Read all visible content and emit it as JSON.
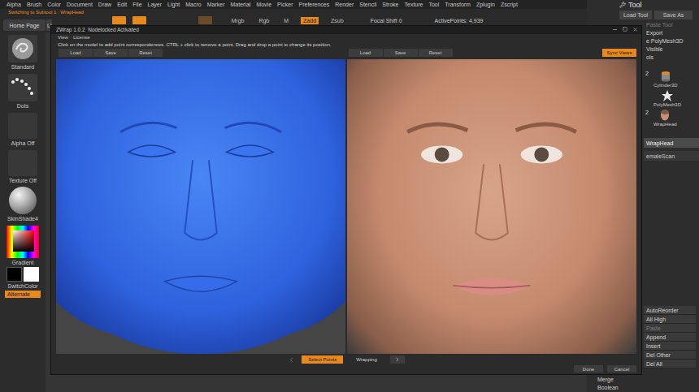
{
  "menu_bar": [
    "Alpha",
    "Brush",
    "Color",
    "Document",
    "Draw",
    "Edit",
    "File",
    "Layer",
    "Light",
    "Macro",
    "Marker",
    "Material",
    "Movie",
    "Picker",
    "Preferences",
    "Render",
    "Stencil",
    "Stroke",
    "Texture",
    "Tool",
    "Transform",
    "Zplugin",
    "Zscript"
  ],
  "status_message": "Switching to Subtool 1 : WrapHead",
  "toolbar": {
    "home_button": "Home Page",
    "partial_button": "Li",
    "tool_buttons": [
      {
        "selected": true
      },
      {
        "selected": true
      },
      {
        "selected": false
      }
    ],
    "modes": [
      {
        "label": "Mrgb",
        "selected": false
      },
      {
        "label": "Rgb",
        "selected": false
      },
      {
        "label": "M",
        "selected": false
      },
      {
        "label": "Zadd",
        "selected": true
      },
      {
        "label": "Zsub",
        "selected": false
      }
    ],
    "focal_shift": "Focal Shift 0",
    "active_points": "ActivePoints: 4,939"
  },
  "left_shelf": {
    "brush": "Standard",
    "stroke": "Dots",
    "alpha": "Alpha Off",
    "texture": "Texture Off",
    "material": "SkinShade4",
    "gradient": "Gradient",
    "switch_color": "SwitchColor",
    "alternate": {
      "label": "Alternate",
      "selected": true
    }
  },
  "dialog": {
    "title": "ZWrap 1.0.2  Nodelocked Activated",
    "menu": [
      "View",
      "License"
    ],
    "instruction": "Click on the model to add point correspondences. CTRL + click to remove a point. Drag and drop a point to change its position.",
    "left_buttons": [
      "Load",
      "Save",
      "Reset"
    ],
    "right_buttons": [
      "Load",
      "Save",
      "Reset"
    ],
    "sync_views": {
      "label": "Sync Views",
      "selected": true
    },
    "steps": [
      {
        "label": "Select Points",
        "selected": true
      },
      {
        "label": "Wrapping",
        "selected": false
      }
    ],
    "actions": [
      "Done",
      "Cancel"
    ]
  },
  "tool_panel": {
    "title": "Tool",
    "top_buttons": [
      "Load Tool",
      "Save As"
    ],
    "items": [
      {
        "label": "Paste Tool",
        "disabled": true
      },
      {
        "label": "Export",
        "disabled": false
      },
      {
        "label": "e PolyMesh3D",
        "disabled": false
      },
      {
        "label": "Visible",
        "disabled": false
      },
      {
        "label": "ols",
        "disabled": false
      }
    ],
    "thumbnails": [
      {
        "label": "Cylinder3D",
        "badge": "2"
      },
      {
        "label": "PolyMesh3D"
      },
      {
        "label": "WrapHead",
        "badge": "2"
      }
    ],
    "subtools": [
      {
        "label": "WrapHead",
        "selected": true
      },
      {
        "label": "emaleScan",
        "selected": false
      }
    ],
    "subtool_buttons": [
      {
        "label": "AutoReorder",
        "disabled": false
      },
      {
        "label": "All High",
        "disabled": false
      },
      {
        "label": "Paste",
        "disabled": true
      },
      {
        "label": "Append",
        "disabled": false
      },
      {
        "label": "Insert",
        "disabled": false
      },
      {
        "label": "Del Other",
        "disabled": false
      },
      {
        "label": "Del All",
        "disabled": false
      }
    ],
    "bottom_buttons": [
      "Merge",
      "Boolean"
    ]
  }
}
